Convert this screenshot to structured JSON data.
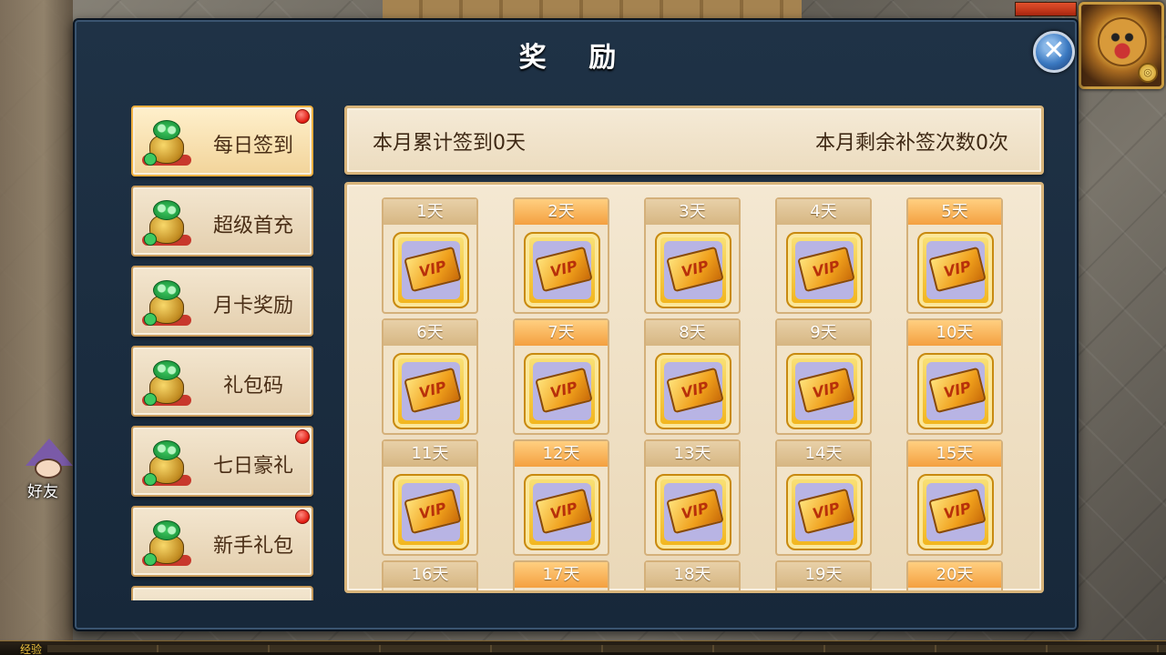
{
  "window": {
    "title": "奖 励",
    "close_icon": "close-icon"
  },
  "menu": {
    "items": [
      {
        "label": "每日签到",
        "active": true,
        "badge": true
      },
      {
        "label": "超级首充",
        "active": false,
        "badge": false
      },
      {
        "label": "月卡奖励",
        "active": false,
        "badge": false
      },
      {
        "label": "礼包码",
        "active": false,
        "badge": false
      },
      {
        "label": "七日豪礼",
        "active": false,
        "badge": true
      },
      {
        "label": "新手礼包",
        "active": false,
        "badge": true
      }
    ]
  },
  "signin": {
    "monthly_total": "本月累计签到0天",
    "makeup_remaining": "本月剩余补签次数0次",
    "days": [
      {
        "label": "1天",
        "highlight": false
      },
      {
        "label": "2天",
        "highlight": true
      },
      {
        "label": "3天",
        "highlight": false
      },
      {
        "label": "4天",
        "highlight": false
      },
      {
        "label": "5天",
        "highlight": true
      },
      {
        "label": "6天",
        "highlight": false
      },
      {
        "label": "7天",
        "highlight": true
      },
      {
        "label": "8天",
        "highlight": false
      },
      {
        "label": "9天",
        "highlight": false
      },
      {
        "label": "10天",
        "highlight": true
      },
      {
        "label": "11天",
        "highlight": false
      },
      {
        "label": "12天",
        "highlight": true
      },
      {
        "label": "13天",
        "highlight": false
      },
      {
        "label": "14天",
        "highlight": false
      },
      {
        "label": "15天",
        "highlight": true
      },
      {
        "label": "16天",
        "highlight": false
      },
      {
        "label": "17天",
        "highlight": true
      },
      {
        "label": "18天",
        "highlight": false
      },
      {
        "label": "19天",
        "highlight": false
      },
      {
        "label": "20天",
        "highlight": true
      }
    ],
    "reward_icon": "vip-card-icon",
    "reward_text": "VIP"
  },
  "hud": {
    "friend_label": "好友",
    "exp_label": "经验"
  }
}
